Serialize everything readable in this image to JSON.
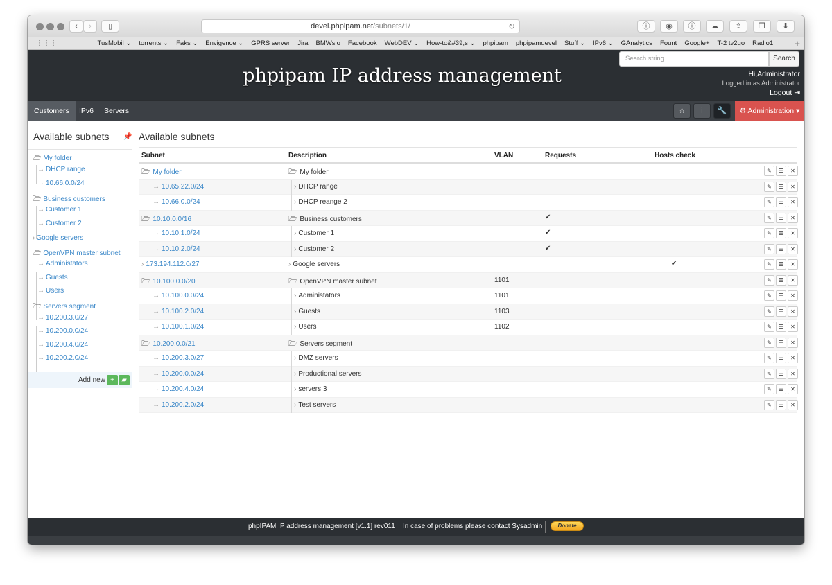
{
  "browser": {
    "url_host": "devel.phpipam.net",
    "url_path": "/subnets/1/",
    "bookmarks": [
      "TusMobil ⌄",
      "torrents ⌄",
      "Faks ⌄",
      "Envigence ⌄",
      "GPRS server",
      "Jira",
      "BMWslo",
      "Facebook",
      "WebDEV ⌄",
      "How-to&#39;s ⌄",
      "phpipam",
      "phpipamdevel",
      "Stuff ⌄",
      "IPv6 ⌄",
      "GAnalytics",
      "Fount",
      "Google+",
      "T-2 tv2go",
      "Radio1"
    ]
  },
  "header": {
    "title": "phpipam IP address management",
    "search_placeholder": "Search string",
    "search_button": "Search",
    "user_greeting": "Hi,Administrator",
    "logged_in_as": "Logged in as Administrator",
    "logout": "Logout"
  },
  "nav": {
    "items": [
      "Customers",
      "IPv6",
      "Servers"
    ],
    "admin": "Administration"
  },
  "sidebar": {
    "title": "Available subnets",
    "items": [
      "My folder",
      "DHCP range",
      "10.66.0.0/24",
      "Business customers",
      "Customer 1",
      "Customer 2",
      "Google servers",
      "OpenVPN master subnet",
      "Administators",
      "Guests",
      "Users",
      "Servers segment",
      "10.200.3.0/27",
      "10.200.0.0/24",
      "10.200.4.0/24",
      "10.200.2.0/24"
    ],
    "add_new": "Add new"
  },
  "content": {
    "title": "Available subnets",
    "columns": [
      "Subnet",
      "Description",
      "VLAN",
      "Requests",
      "Hosts check"
    ],
    "rows": [
      {
        "subnet": "My folder",
        "desc": "My folder",
        "vlan": ""
      },
      {
        "subnet": "10.65.22.0/24",
        "desc": "DHCP range",
        "vlan": ""
      },
      {
        "subnet": "10.66.0.0/24",
        "desc": "DHCP reange 2",
        "vlan": ""
      },
      {
        "subnet": "10.10.0.0/16",
        "desc": "Business customers",
        "vlan": ""
      },
      {
        "subnet": "10.10.1.0/24",
        "desc": "Customer 1",
        "vlan": ""
      },
      {
        "subnet": "10.10.2.0/24",
        "desc": "Customer 2",
        "vlan": ""
      },
      {
        "subnet": "173.194.112.0/27",
        "desc": "Google servers",
        "vlan": ""
      },
      {
        "subnet": "10.100.0.0/20",
        "desc": "OpenVPN master subnet",
        "vlan": "1101"
      },
      {
        "subnet": "10.100.0.0/24",
        "desc": "Administators",
        "vlan": "1101"
      },
      {
        "subnet": "10.100.2.0/24",
        "desc": "Guests",
        "vlan": "1103"
      },
      {
        "subnet": "10.100.1.0/24",
        "desc": "Users",
        "vlan": "1102"
      },
      {
        "subnet": "10.200.0.0/21",
        "desc": "Servers segment",
        "vlan": ""
      },
      {
        "subnet": "10.200.3.0/27",
        "desc": "DMZ servers",
        "vlan": ""
      },
      {
        "subnet": "10.200.0.0/24",
        "desc": "Productional servers",
        "vlan": ""
      },
      {
        "subnet": "10.200.4.0/24",
        "desc": "servers 3",
        "vlan": ""
      },
      {
        "subnet": "10.200.2.0/24",
        "desc": "Test servers",
        "vlan": ""
      }
    ]
  },
  "footer": {
    "version": "phpIPAM IP address management [v1.1] rev011",
    "contact": "In case of problems please contact Sysadmin",
    "donate": "Donate"
  }
}
